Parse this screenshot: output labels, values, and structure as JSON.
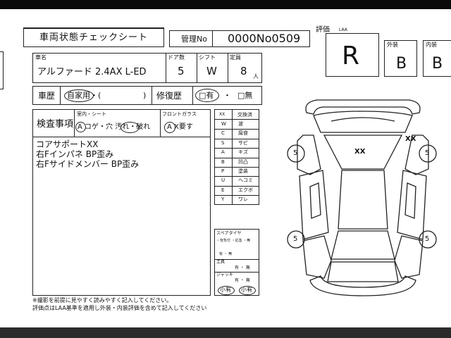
{
  "sheet": {
    "title": "車両状態チェックシート",
    "mgmt_label": "管理No",
    "mgmt_value": "0000No0509",
    "rating_label": "評価",
    "rating_sub": "LAA",
    "overall_grade": "R",
    "exterior_label": "外装",
    "exterior_grade": "B",
    "interior_label": "内装",
    "interior_grade": "B"
  },
  "vehicle": {
    "name_label": "車名",
    "name_value": "アルファード 2.4AX L-ED",
    "doors_label": "ドア数",
    "doors_value": "5",
    "shift_label": "シフト",
    "shift_value": "W",
    "capacity_label": "定員",
    "capacity_value": "8",
    "capacity_unit": "人"
  },
  "history": {
    "history_label": "車歴",
    "history_value": "自家用・(",
    "history_close": ")",
    "repair_label": "修復歴",
    "repair_yes": "□有",
    "repair_sep": "・",
    "repair_no": "□無"
  },
  "inspection": {
    "label": "検査事項",
    "interior_header": "室内・シート",
    "interior_options": "A コゲ・穴 汚れ・破れ",
    "windshield_header": "フロントガラス",
    "windshield_options": "A X要す",
    "notes": [
      "コアサポートXX",
      "右Fインパネ BP歪み",
      "右Fサイドメンバー BP歪み"
    ]
  },
  "legend": {
    "header_code": "XX",
    "header_desc": "交換済",
    "rows": [
      {
        "code": "W",
        "desc": "波"
      },
      {
        "code": "C",
        "desc": "腐食"
      },
      {
        "code": "S",
        "desc": "サビ"
      },
      {
        "code": "A",
        "desc": "キズ"
      },
      {
        "code": "B",
        "desc": "凹凸"
      },
      {
        "code": "P",
        "desc": "塗装"
      },
      {
        "code": "U",
        "desc": "ヘコミ"
      },
      {
        "code": "E",
        "desc": "エクボ"
      },
      {
        "code": "Y",
        "desc": "ワレ"
      }
    ]
  },
  "equipment": {
    "spare_label": "スペアタイヤ",
    "spare_options": "・背負付 ・応急 ・無",
    "spare_note": "有 ・ 無",
    "tools_label": "工具",
    "tools_value": "有 ・ 無",
    "jack_label": "ジャッキ",
    "jack_value": "有 ・ 無",
    "bottom_left": "小有",
    "bottom_right": "小有"
  },
  "diagram": {
    "front_mark": "XX",
    "corner_mark": "XX",
    "tire_labels": [
      "5",
      "5",
      "5",
      "5"
    ]
  },
  "footer": {
    "line1": "※撮影を前提に見やすく読みやすく記入してください。",
    "line2": "評価点はLAA基準を適用し外装・内装評価を含めて記入してください"
  }
}
